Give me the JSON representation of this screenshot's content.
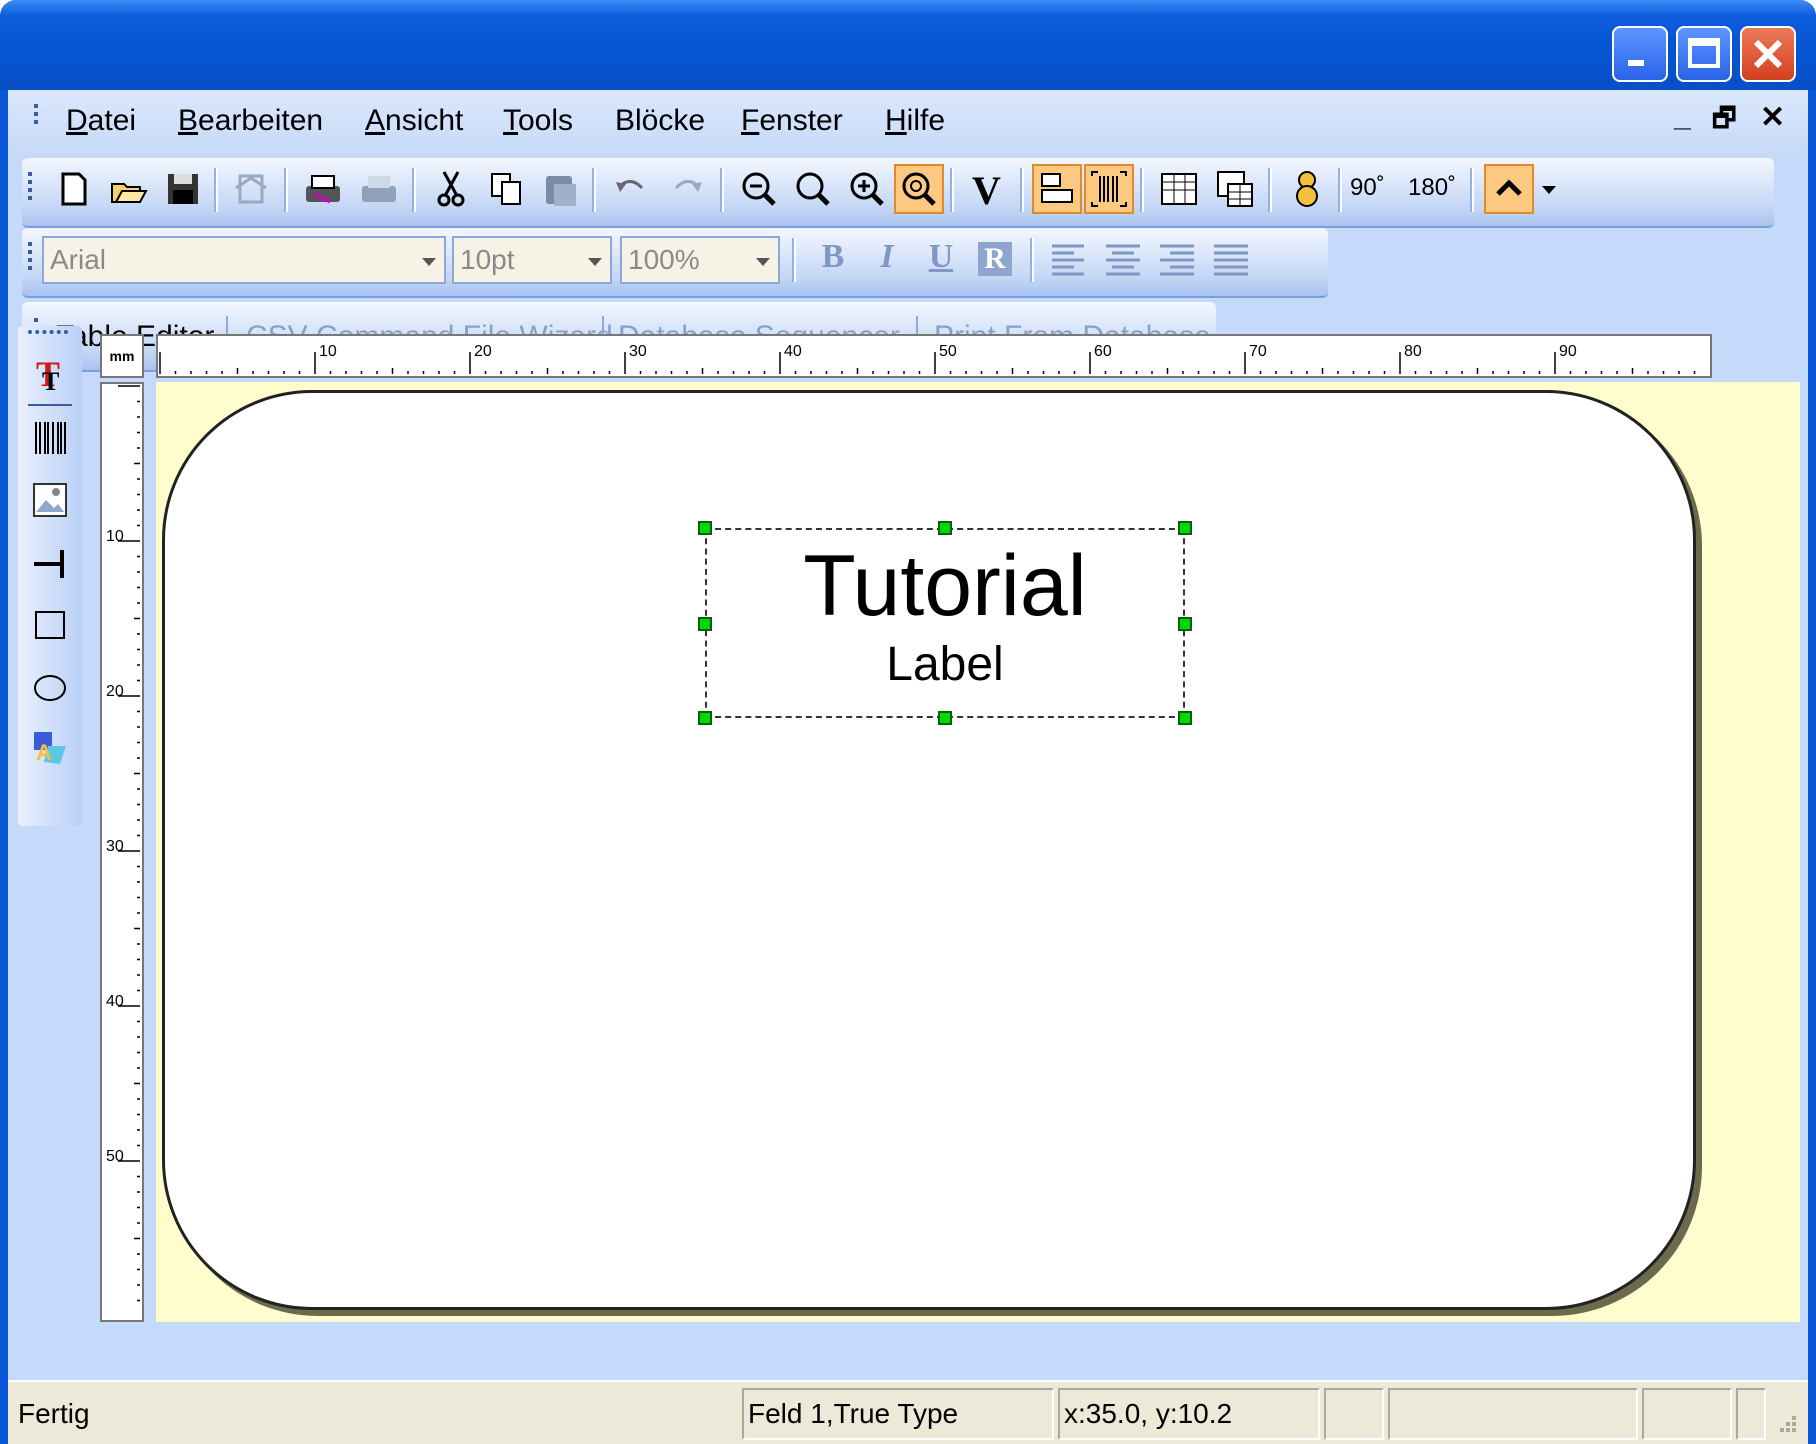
{
  "menu": {
    "items": [
      {
        "label": "Datei",
        "accel": "D",
        "rest": "atei"
      },
      {
        "label": "Bearbeiten",
        "accel": "B",
        "rest": "earbeiten"
      },
      {
        "label": "Ansicht",
        "accel": "A",
        "rest": "nsicht"
      },
      {
        "label": "Tools",
        "accel": "T",
        "rest": "ools"
      },
      {
        "label": "Blöcke",
        "accel": "",
        "rest": "Blöcke"
      },
      {
        "label": "Fenster",
        "accel": "F",
        "rest": "enster"
      },
      {
        "label": "Hilfe",
        "accel": "H",
        "rest": "ilfe"
      }
    ],
    "mdi_controls": [
      "_",
      "🗗",
      "✕"
    ]
  },
  "format_toolbar": {
    "font": "Arial",
    "size": "10pt",
    "zoom": "100%",
    "bold": "B",
    "italic": "I",
    "underline": "U",
    "reverse": "R"
  },
  "rotate": {
    "r90": "90˚",
    "r180": "180˚"
  },
  "links_toolbar": {
    "items": [
      "Table Editor",
      "CSV Command File Wizard",
      "Database Sequencer",
      "Print From Database"
    ]
  },
  "ruler": {
    "unit": "mm",
    "h_labels": [
      "10",
      "20",
      "30",
      "40",
      "50",
      "60",
      "70",
      "80",
      "90"
    ],
    "v_labels": [
      "10",
      "20",
      "30",
      "40",
      "50"
    ]
  },
  "label_field": {
    "line1": "Tutorial",
    "line2": "Label"
  },
  "status": {
    "ready": "Fertig",
    "field_info": "Feld 1,True Type",
    "coords": "x:35.0, y:10.2"
  },
  "colors": {
    "titlebar": "#0554d3",
    "toolbar_active": "#fdc981",
    "canvas_bg": "#fffdcd",
    "handle": "#00d800"
  }
}
